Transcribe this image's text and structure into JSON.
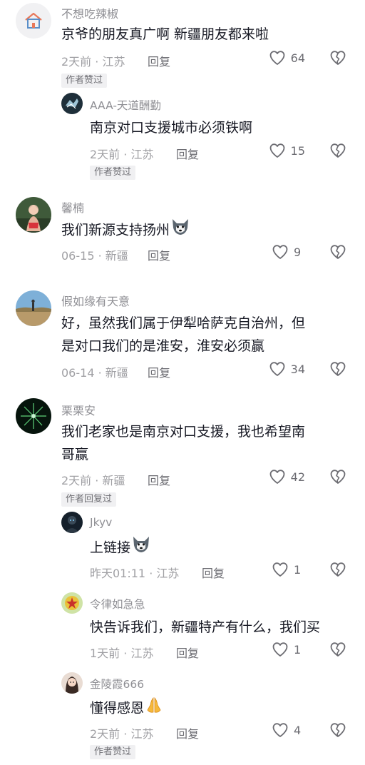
{
  "comments": [
    {
      "name": "不想吃辣椒",
      "text": [
        "京爷的朋友真广啊 新疆朋友都来啦"
      ],
      "time": "2天前",
      "location": "江苏",
      "reply": "回复",
      "likes": "64",
      "badge": "作者赞过",
      "avatar_icon": "house-icon"
    },
    {
      "name": "AAA-天道酬勤",
      "text": [
        "南京对口支援城市必须铁啊"
      ],
      "time": "2天前",
      "location": "江苏",
      "reply": "回复",
      "likes": "15",
      "badge": "作者赞过"
    },
    {
      "name": "馨楠",
      "text": [
        "我们新源支持扬州"
      ],
      "emoji": "husky-emoji",
      "time": "06-15",
      "location": "新疆",
      "reply": "回复",
      "likes": "9"
    },
    {
      "name": "假如缘有天意",
      "text": [
        "好，虽然我们属于伊犁哈萨克自治州，但",
        "是对口我们的是淮安，淮安必须赢"
      ],
      "time": "06-14",
      "location": "新疆",
      "reply": "回复",
      "likes": "34"
    },
    {
      "name": "栗栗安",
      "text": [
        "我们老家也是南京对口支援，我也希望南",
        "哥赢"
      ],
      "time": "2天前",
      "location": "新疆",
      "reply": "回复",
      "likes": "42",
      "badge": "作者回复过"
    },
    {
      "name": "Jkyv",
      "text": [
        "上链接"
      ],
      "emoji": "husky-emoji",
      "time": "昨天01:11",
      "location": "江苏",
      "reply": "回复",
      "likes": "1"
    },
    {
      "name": "令律如急急",
      "text": [
        "快告诉我们，新疆特产有什么，我们买"
      ],
      "time": "1天前",
      "location": "江苏",
      "reply": "回复",
      "likes": "1"
    },
    {
      "name": "金陵霞666",
      "text": [
        "懂得感恩"
      ],
      "emoji": "praying-hands-emoji",
      "time": "2天前",
      "location": "江苏",
      "reply": "回复",
      "likes": "4",
      "badge": "作者赞过"
    }
  ],
  "meta_separator": " · ",
  "colors": {
    "text": "#161823",
    "secondary": "#a0a0a4",
    "badge_bg": "#f0f0f2"
  }
}
